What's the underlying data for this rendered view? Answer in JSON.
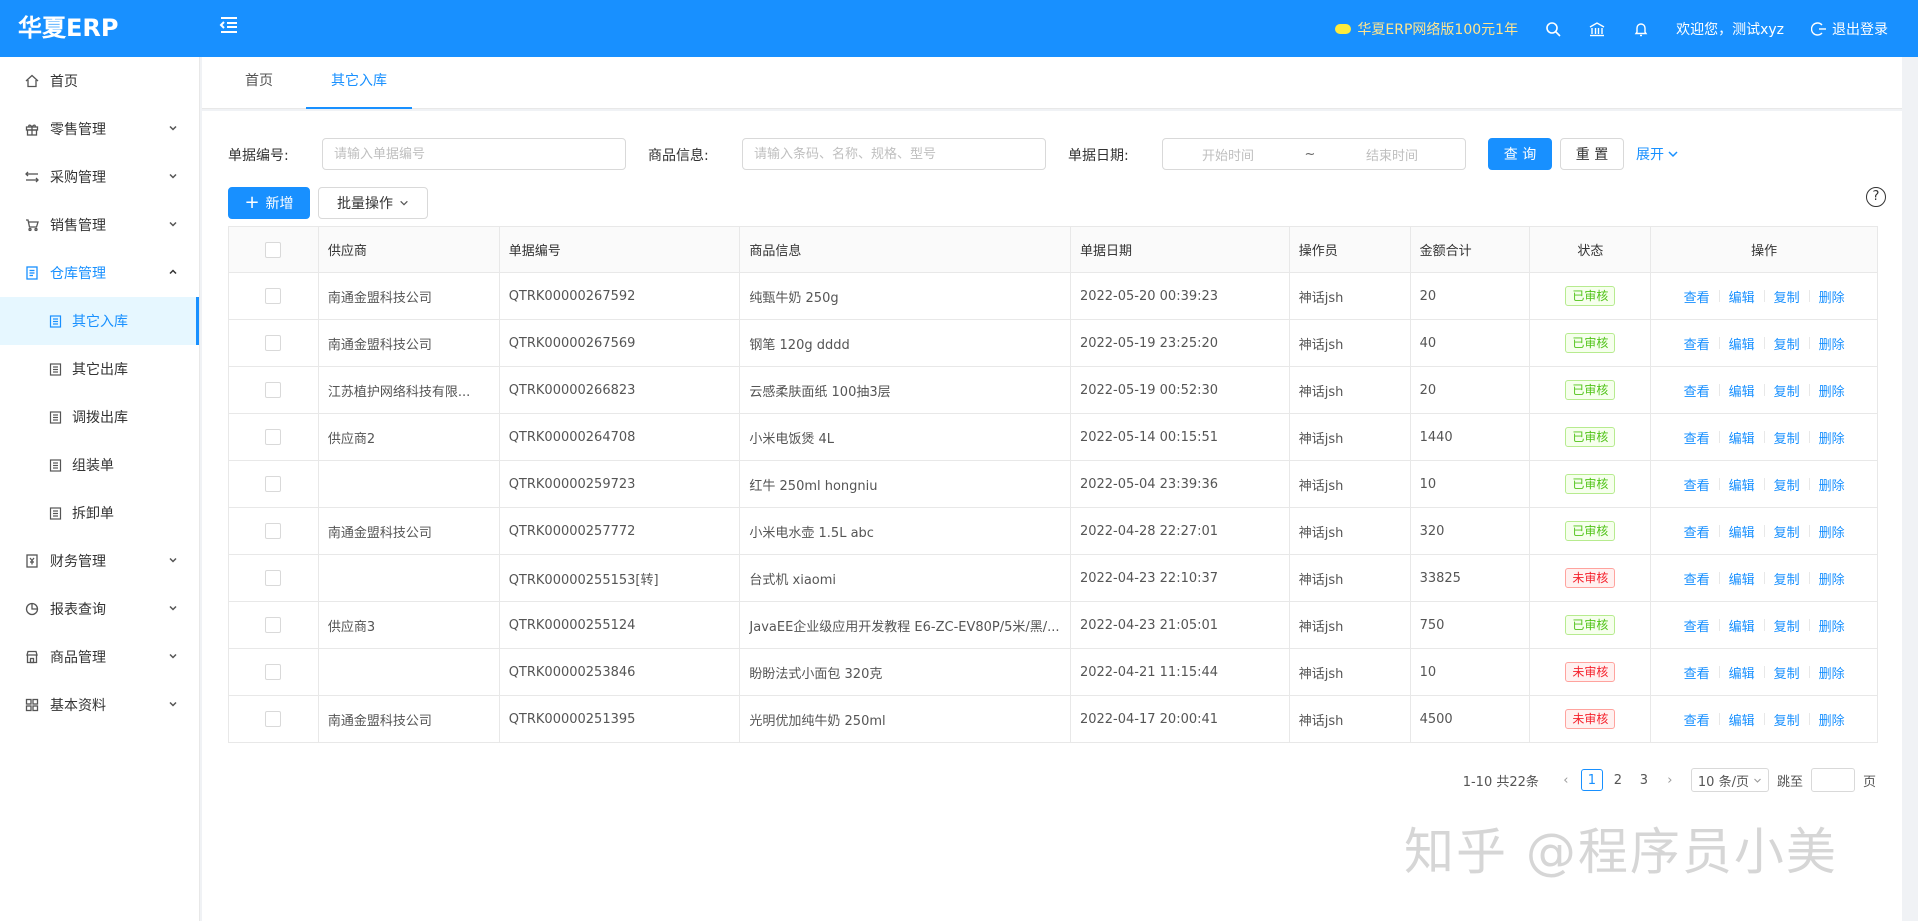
{
  "header": {
    "logo": "华夏ERP",
    "promo": "华夏ERP网络版100元1年",
    "welcome": "欢迎您，测试xyz",
    "logout": "退出登录"
  },
  "sidebar": {
    "items": [
      {
        "label": "首页"
      },
      {
        "label": "零售管理"
      },
      {
        "label": "采购管理"
      },
      {
        "label": "销售管理"
      },
      {
        "label": "仓库管理"
      },
      {
        "label": "财务管理"
      },
      {
        "label": "报表查询"
      },
      {
        "label": "商品管理"
      },
      {
        "label": "基本资料"
      }
    ],
    "sub_items": [
      {
        "label": "其它入库"
      },
      {
        "label": "其它出库"
      },
      {
        "label": "调拨出库"
      },
      {
        "label": "组装单"
      },
      {
        "label": "拆卸单"
      }
    ]
  },
  "tabs": [
    {
      "label": "首页"
    },
    {
      "label": "其它入库"
    }
  ],
  "search": {
    "bill_no_label": "单据编号:",
    "bill_no_placeholder": "请输入单据编号",
    "goods_label": "商品信息:",
    "goods_placeholder": "请输入条码、名称、规格、型号",
    "date_label": "单据日期:",
    "date_start": "开始时间",
    "date_sep": "~",
    "date_end": "结束时间",
    "query": "查 询",
    "reset": "重 置",
    "expand": "展开"
  },
  "toolbar": {
    "add": "新增",
    "batch": "批量操作"
  },
  "table": {
    "columns": [
      "供应商",
      "单据编号",
      "商品信息",
      "单据日期",
      "操作员",
      "金额合计",
      "状态",
      "操作"
    ],
    "actions": [
      "查看",
      "编辑",
      "复制",
      "删除"
    ],
    "rows": [
      {
        "supplier": "南通金盟科技公司",
        "no": "QTRK00000267592",
        "goods": "纯甄牛奶 250g",
        "date": "2022-05-20 00:39:23",
        "operator": "神话jsh",
        "amount": "20",
        "status": "已审核"
      },
      {
        "supplier": "南通金盟科技公司",
        "no": "QTRK00000267569",
        "goods": "钢笔 120g dddd",
        "date": "2022-05-19 23:25:20",
        "operator": "神话jsh",
        "amount": "40",
        "status": "已审核"
      },
      {
        "supplier": "江苏植护网络科技有限...",
        "no": "QTRK00000266823",
        "goods": "云感柔肤面纸 100抽3层",
        "date": "2022-05-19 00:52:30",
        "operator": "神话jsh",
        "amount": "20",
        "status": "已审核"
      },
      {
        "supplier": "供应商2",
        "no": "QTRK00000264708",
        "goods": "小米电饭煲 4L",
        "date": "2022-05-14 00:15:51",
        "operator": "神话jsh",
        "amount": "1440",
        "status": "已审核"
      },
      {
        "supplier": "",
        "no": "QTRK00000259723",
        "goods": "红牛 250ml hongniu",
        "date": "2022-05-04 23:39:36",
        "operator": "神话jsh",
        "amount": "10",
        "status": "已审核"
      },
      {
        "supplier": "南通金盟科技公司",
        "no": "QTRK00000257772",
        "goods": "小米电水壶 1.5L abc",
        "date": "2022-04-28 22:27:01",
        "operator": "神话jsh",
        "amount": "320",
        "status": "已审核"
      },
      {
        "supplier": "",
        "no": "QTRK00000255153[转]",
        "goods": "台式机 xiaomi",
        "date": "2022-04-23 22:10:37",
        "operator": "神话jsh",
        "amount": "33825",
        "status": "未审核"
      },
      {
        "supplier": "供应商3",
        "no": "QTRK00000255124",
        "goods": "JavaEE企业级应用开发教程 E6-ZC-EV80P/5米/黑/...",
        "date": "2022-04-23 21:05:01",
        "operator": "神话jsh",
        "amount": "750",
        "status": "已审核"
      },
      {
        "supplier": "",
        "no": "QTRK00000253846",
        "goods": "盼盼法式小面包 320克",
        "date": "2022-04-21 11:15:44",
        "operator": "神话jsh",
        "amount": "10",
        "status": "未审核"
      },
      {
        "supplier": "南通金盟科技公司",
        "no": "QTRK00000251395",
        "goods": "光明优加纯牛奶 250ml",
        "date": "2022-04-17 20:00:41",
        "operator": "神话jsh",
        "amount": "4500",
        "status": "未审核"
      }
    ]
  },
  "pagination": {
    "total": "1-10 共22条",
    "pages": [
      "1",
      "2",
      "3"
    ],
    "current": "1",
    "page_size": "10 条/页",
    "jump_label": "跳至",
    "page_unit": "页"
  },
  "watermark": "知乎 @程序员小美",
  "colors": {
    "primary": "#1890ff",
    "approved": "#52c41a",
    "unapproved": "#f5222d"
  }
}
